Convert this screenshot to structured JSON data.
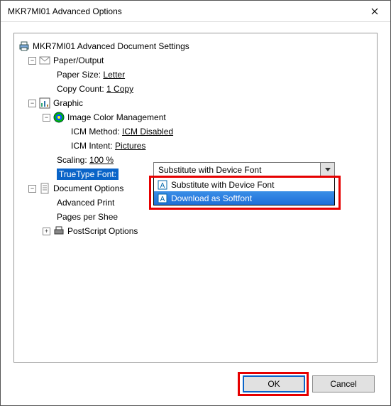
{
  "window": {
    "title": "MKR7MI01 Advanced Options"
  },
  "tree": {
    "root": "MKR7MI01 Advanced Document Settings",
    "paper_output": {
      "label": "Paper/Output",
      "paper_size_label": "Paper Size:",
      "paper_size_value": "Letter",
      "copy_count_label": "Copy Count:",
      "copy_count_value": "1 Copy"
    },
    "graphic": {
      "label": "Graphic",
      "icm": {
        "label": "Image Color Management",
        "method_label": "ICM Method:",
        "method_value": "ICM Disabled",
        "intent_label": "ICM Intent:",
        "intent_value": "Pictures"
      },
      "scaling_label": "Scaling:",
      "scaling_value": "100 %",
      "truetype_label": "TrueType Font:"
    },
    "document_options": {
      "label": "Document Options",
      "advanced_print": "Advanced Print",
      "pages_per_sheet": "Pages per Shee",
      "postscript": "PostScript Options"
    }
  },
  "combo": {
    "selected": "Substitute with Device Font",
    "options": {
      "opt1": "Substitute with Device Font",
      "opt2": "Download as Softfont"
    }
  },
  "buttons": {
    "ok": "OK",
    "cancel": "Cancel"
  }
}
